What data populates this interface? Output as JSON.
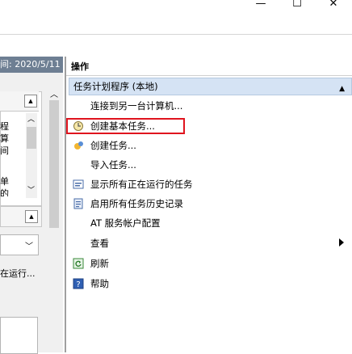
{
  "window": {
    "minimize_glyph": "—",
    "maximize_glyph": "☐",
    "close_glyph": "✕"
  },
  "left": {
    "header_text": "间: 2020/5/11",
    "list_chars": [
      "程",
      "算",
      "间",
      "单",
      "的"
    ],
    "status_text": "在运行..."
  },
  "right": {
    "pane_title": "操作",
    "section_title": "任务计划程序 (本地)",
    "items": [
      {
        "label": "连接到另一台计算机...",
        "icon": ""
      },
      {
        "label": "创建基本任务...",
        "icon": "create-basic-task-icon"
      },
      {
        "label": "创建任务...",
        "icon": "create-task-icon"
      },
      {
        "label": "导入任务...",
        "icon": ""
      },
      {
        "label": "显示所有正在运行的任务",
        "icon": "running-tasks-icon"
      },
      {
        "label": "启用所有任务历史记录",
        "icon": "history-icon"
      },
      {
        "label": "AT 服务帐户配置",
        "icon": ""
      },
      {
        "label": "查看",
        "icon": ""
      },
      {
        "label": "刷新",
        "icon": "refresh-icon"
      },
      {
        "label": "帮助",
        "icon": "help-icon"
      }
    ]
  },
  "colors": {
    "left_header_bg": "#6e7f93",
    "section_bg": "#d5e3f4",
    "highlight_border": "#e0141e"
  }
}
